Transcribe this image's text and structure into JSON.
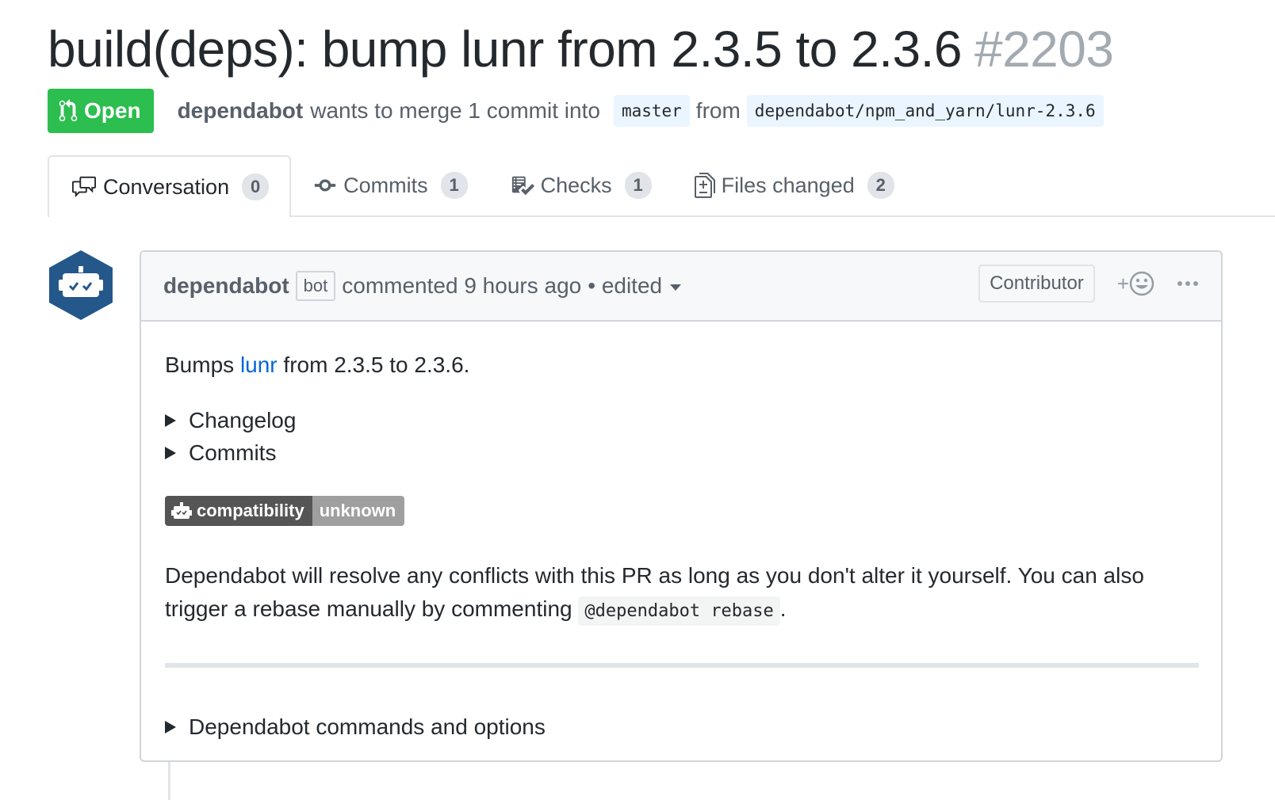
{
  "pr": {
    "title": "build(deps): bump lunr from 2.3.5 to 2.3.6",
    "number": "#2203",
    "state": "Open",
    "author": "dependabot",
    "merge_text": "wants to merge 1 commit into",
    "base_branch": "master",
    "from_text": "from",
    "head_branch": "dependabot/npm_and_yarn/lunr-2.3.6"
  },
  "tabs": [
    {
      "label": "Conversation",
      "count": "0",
      "icon": "comment-discussion-icon"
    },
    {
      "label": "Commits",
      "count": "1",
      "icon": "git-commit-icon"
    },
    {
      "label": "Checks",
      "count": "1",
      "icon": "checklist-icon"
    },
    {
      "label": "Files changed",
      "count": "2",
      "icon": "file-diff-icon"
    }
  ],
  "comment": {
    "author": "dependabot",
    "bot_label": "bot",
    "when": "commented 9 hours ago",
    "edited": "• edited",
    "role": "Contributor",
    "react_plus": "+",
    "bumps_prefix": "Bumps",
    "bumps_link": "lunr",
    "bumps_suffix": "from 2.3.5 to 2.3.6.",
    "details": [
      "Changelog",
      "Commits"
    ],
    "badge_left": "compatibility",
    "badge_right": "unknown",
    "para_text": "Dependabot will resolve any conflicts with this PR as long as you don't alter it yourself. You can also trigger a rebase manually by commenting",
    "para_code": "@dependabot rebase",
    "para_end": ".",
    "commands": "Dependabot commands and options"
  },
  "colors": {
    "open_green": "#2cbe4e",
    "link_blue": "#0366d6",
    "avatar_blue": "#24578a"
  }
}
